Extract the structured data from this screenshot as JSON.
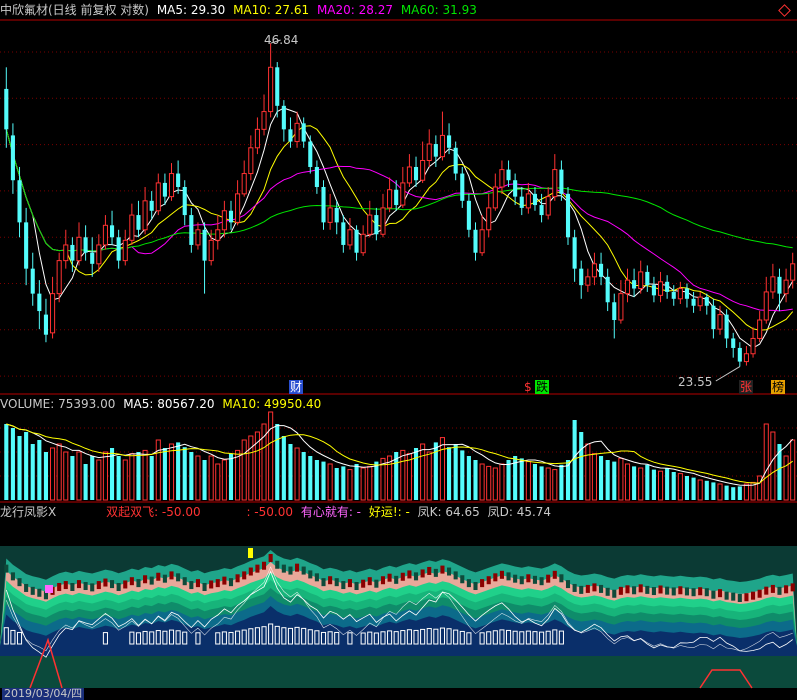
{
  "colors": {
    "bg": "#000000",
    "grid": "#7a0000",
    "up": "#ff3232",
    "down": "#54fcfc",
    "ma5": "#ffffff",
    "ma10": "#ffff00",
    "ma20": "#ff00ff",
    "ma60": "#00e600",
    "label": "#c8c8c8"
  },
  "header_price": {
    "stock": "中欣氟材(日线 前复权 对数)",
    "ma5": "MA5: 29.30",
    "ma10": "MA10: 27.61",
    "ma20": "MA20: 28.27",
    "ma60": "MA60: 31.93",
    "corner_icon": "diamond-icon"
  },
  "header_volume": {
    "volume": "VOLUME: 75393.00",
    "ma5": "MA5: 80567.20",
    "ma10": "MA10: 49950.40"
  },
  "header_indicator": {
    "name": "龙行凤影X",
    "shuangqi": "双起双飞: -50.00",
    "extra": ": -50.00",
    "youxin": "有心就有: -",
    "haoyun": "好运!: -",
    "fengk": "凤K: 64.65",
    "fengd": "凤D: 45.74"
  },
  "annotations": {
    "high": "46.84",
    "low": "23.55",
    "cai": "财",
    "dollar": "$",
    "die": "跌",
    "zhang": "张",
    "bang": "榜"
  },
  "date_label": "2019/03/04/四",
  "chart_data": {
    "type": "candlestick",
    "title": "中欣氟材(日线 前复权 对数)",
    "high_marker": 46.84,
    "low_marker": 23.55,
    "price_range": [
      22.5,
      49
    ],
    "last_ma": {
      "MA5": 29.3,
      "MA10": 27.61,
      "MA20": 28.27,
      "MA60": 31.93
    },
    "candles": [
      {
        "o": 42.5,
        "c": 39,
        "h": 44.5,
        "l": 37.5
      },
      {
        "o": 38.5,
        "c": 35,
        "h": 39.5,
        "l": 34
      },
      {
        "o": 35,
        "c": 32,
        "h": 36,
        "l": 31
      },
      {
        "o": 32,
        "c": 29,
        "h": 33,
        "l": 28
      },
      {
        "o": 29,
        "c": 27.5,
        "h": 30,
        "l": 26.8
      },
      {
        "o": 27.5,
        "c": 26.5,
        "h": 28.3,
        "l": 25.5
      },
      {
        "o": 26.3,
        "c": 25.2,
        "h": 27.2,
        "l": 24.8
      },
      {
        "o": 25.3,
        "c": 27.5,
        "h": 28.5,
        "l": 25
      },
      {
        "o": 27.5,
        "c": 29.5,
        "h": 30,
        "l": 27
      },
      {
        "o": 29.5,
        "c": 30.5,
        "h": 31.5,
        "l": 29
      },
      {
        "o": 30.5,
        "c": 29.5,
        "h": 31,
        "l": 28.8
      },
      {
        "o": 29.5,
        "c": 31,
        "h": 32,
        "l": 29.2
      },
      {
        "o": 31,
        "c": 30,
        "h": 31.8,
        "l": 29.5
      },
      {
        "o": 30,
        "c": 29.3,
        "h": 31,
        "l": 28.5
      },
      {
        "o": 29.3,
        "c": 30.5,
        "h": 31.2,
        "l": 28.8
      },
      {
        "o": 30.5,
        "c": 31.8,
        "h": 32.5,
        "l": 30.2
      },
      {
        "o": 31.8,
        "c": 31,
        "h": 32.8,
        "l": 30.5
      },
      {
        "o": 31,
        "c": 29.5,
        "h": 31.5,
        "l": 29
      },
      {
        "o": 29.5,
        "c": 30.8,
        "h": 31.5,
        "l": 29.2
      },
      {
        "o": 30.8,
        "c": 32.5,
        "h": 33.3,
        "l": 30.5
      },
      {
        "o": 32.5,
        "c": 31.5,
        "h": 33.5,
        "l": 31
      },
      {
        "o": 31.5,
        "c": 33.5,
        "h": 34.5,
        "l": 31.2
      },
      {
        "o": 33.5,
        "c": 32.8,
        "h": 34.2,
        "l": 32.2
      },
      {
        "o": 32.8,
        "c": 34.8,
        "h": 35.5,
        "l": 32.5
      },
      {
        "o": 34.8,
        "c": 33.8,
        "h": 35.5,
        "l": 33.2
      },
      {
        "o": 33.8,
        "c": 35.5,
        "h": 36.3,
        "l": 33.5
      },
      {
        "o": 35.5,
        "c": 34.5,
        "h": 36.5,
        "l": 34
      },
      {
        "o": 34.5,
        "c": 32.5,
        "h": 35,
        "l": 31.8
      },
      {
        "o": 32.5,
        "c": 30.5,
        "h": 33,
        "l": 30
      },
      {
        "o": 30.5,
        "c": 31.5,
        "h": 32,
        "l": 30.2
      },
      {
        "o": 31.5,
        "c": 29.5,
        "h": 32,
        "l": 27.5
      },
      {
        "o": 29.5,
        "c": 30.8,
        "h": 31.5,
        "l": 29.2
      },
      {
        "o": 30.8,
        "c": 31.5,
        "h": 32.5,
        "l": 30.2
      },
      {
        "o": 31.5,
        "c": 32.8,
        "h": 33.5,
        "l": 31
      },
      {
        "o": 32.8,
        "c": 32,
        "h": 33.5,
        "l": 31.5
      },
      {
        "o": 32,
        "c": 34,
        "h": 35,
        "l": 31.8
      },
      {
        "o": 34,
        "c": 35.5,
        "h": 36.5,
        "l": 33.8
      },
      {
        "o": 35.5,
        "c": 37.5,
        "h": 38.5,
        "l": 35
      },
      {
        "o": 37.5,
        "c": 39,
        "h": 40,
        "l": 37
      },
      {
        "o": 39,
        "c": 40.5,
        "h": 42,
        "l": 38.5
      },
      {
        "o": 40.5,
        "c": 44.5,
        "h": 46.84,
        "l": 40
      },
      {
        "o": 44.5,
        "c": 41,
        "h": 45,
        "l": 40
      },
      {
        "o": 41,
        "c": 39,
        "h": 41.5,
        "l": 38
      },
      {
        "o": 39,
        "c": 38,
        "h": 40,
        "l": 37.5
      },
      {
        "o": 38,
        "c": 39.5,
        "h": 40.5,
        "l": 37.5
      },
      {
        "o": 39.5,
        "c": 38,
        "h": 40,
        "l": 37.5
      },
      {
        "o": 38,
        "c": 36,
        "h": 38.5,
        "l": 35.5
      },
      {
        "o": 36,
        "c": 34.5,
        "h": 36.5,
        "l": 34
      },
      {
        "o": 34.5,
        "c": 32,
        "h": 35,
        "l": 31.5
      },
      {
        "o": 32,
        "c": 33,
        "h": 34,
        "l": 31.5
      },
      {
        "o": 33,
        "c": 32,
        "h": 33.5,
        "l": 31.2
      },
      {
        "o": 32,
        "c": 30.5,
        "h": 32.5,
        "l": 30
      },
      {
        "o": 30.5,
        "c": 31.5,
        "h": 32.3,
        "l": 30.2
      },
      {
        "o": 31.5,
        "c": 30,
        "h": 31.8,
        "l": 29.5
      },
      {
        "o": 30,
        "c": 31.2,
        "h": 31.8,
        "l": 29.8
      },
      {
        "o": 31.2,
        "c": 32.5,
        "h": 33.5,
        "l": 31
      },
      {
        "o": 32.5,
        "c": 31.2,
        "h": 33,
        "l": 30.8
      },
      {
        "o": 31.2,
        "c": 33,
        "h": 34,
        "l": 31
      },
      {
        "o": 33,
        "c": 34.3,
        "h": 35.2,
        "l": 32.7
      },
      {
        "o": 34.3,
        "c": 33.2,
        "h": 35,
        "l": 32.8
      },
      {
        "o": 33.2,
        "c": 34.8,
        "h": 36,
        "l": 33
      },
      {
        "o": 34.8,
        "c": 36,
        "h": 37,
        "l": 34.5
      },
      {
        "o": 36,
        "c": 35,
        "h": 36.8,
        "l": 34.5
      },
      {
        "o": 35,
        "c": 36.5,
        "h": 38,
        "l": 34.8
      },
      {
        "o": 36.5,
        "c": 37.8,
        "h": 39,
        "l": 36
      },
      {
        "o": 37.8,
        "c": 36.8,
        "h": 38.5,
        "l": 36
      },
      {
        "o": 36.8,
        "c": 38.5,
        "h": 40.5,
        "l": 36.5
      },
      {
        "o": 38.5,
        "c": 37.5,
        "h": 39.5,
        "l": 37
      },
      {
        "o": 37.5,
        "c": 35.5,
        "h": 38,
        "l": 35
      },
      {
        "o": 35.5,
        "c": 33.5,
        "h": 36,
        "l": 33
      },
      {
        "o": 33.5,
        "c": 31.5,
        "h": 34,
        "l": 31
      },
      {
        "o": 31.5,
        "c": 30,
        "h": 32,
        "l": 29.5
      },
      {
        "o": 30,
        "c": 31.5,
        "h": 32.5,
        "l": 29.8
      },
      {
        "o": 31.5,
        "c": 33,
        "h": 34,
        "l": 31
      },
      {
        "o": 33,
        "c": 34.5,
        "h": 35.5,
        "l": 32.8
      },
      {
        "o": 34.5,
        "c": 35.8,
        "h": 36.5,
        "l": 34
      },
      {
        "o": 35.8,
        "c": 35,
        "h": 36.5,
        "l": 34.5
      },
      {
        "o": 35,
        "c": 33.8,
        "h": 35.5,
        "l": 33.2
      },
      {
        "o": 33.8,
        "c": 33,
        "h": 34.5,
        "l": 32.5
      },
      {
        "o": 33,
        "c": 34,
        "h": 34.8,
        "l": 32.6
      },
      {
        "o": 34,
        "c": 33.2,
        "h": 34.5,
        "l": 32.8
      },
      {
        "o": 33.2,
        "c": 32.5,
        "h": 34,
        "l": 32
      },
      {
        "o": 32.5,
        "c": 33.8,
        "h": 34.5,
        "l": 32.2
      },
      {
        "o": 33.8,
        "c": 35.8,
        "h": 37,
        "l": 33.5
      },
      {
        "o": 35.8,
        "c": 34,
        "h": 36.5,
        "l": 33.5
      },
      {
        "o": 34,
        "c": 31,
        "h": 34.5,
        "l": 30.5
      },
      {
        "o": 31,
        "c": 29,
        "h": 31.5,
        "l": 28.2
      },
      {
        "o": 29,
        "c": 28,
        "h": 29.5,
        "l": 27.2
      },
      {
        "o": 28,
        "c": 28.5,
        "h": 29,
        "l": 27.6
      },
      {
        "o": 28.5,
        "c": 29.3,
        "h": 30,
        "l": 28
      },
      {
        "o": 29.3,
        "c": 28.5,
        "h": 30,
        "l": 28
      },
      {
        "o": 28.5,
        "c": 27,
        "h": 29,
        "l": 26.5
      },
      {
        "o": 27,
        "c": 26,
        "h": 27.5,
        "l": 25
      },
      {
        "o": 26,
        "c": 27.5,
        "h": 28.3,
        "l": 25.8
      },
      {
        "o": 27.5,
        "c": 28.3,
        "h": 29,
        "l": 27
      },
      {
        "o": 28.3,
        "c": 27.8,
        "h": 29,
        "l": 27.3
      },
      {
        "o": 27.8,
        "c": 28.8,
        "h": 29.5,
        "l": 27.5
      },
      {
        "o": 28.8,
        "c": 28,
        "h": 29.2,
        "l": 27.6
      },
      {
        "o": 28,
        "c": 27.4,
        "h": 28.5,
        "l": 27
      },
      {
        "o": 27.4,
        "c": 28.2,
        "h": 28.8,
        "l": 27
      },
      {
        "o": 28.2,
        "c": 27.6,
        "h": 28.6,
        "l": 27.2
      },
      {
        "o": 27.6,
        "c": 27.2,
        "h": 28,
        "l": 26.8
      },
      {
        "o": 27.2,
        "c": 27.8,
        "h": 28.2,
        "l": 26.9
      },
      {
        "o": 27.8,
        "c": 27.2,
        "h": 28.1,
        "l": 26.7
      },
      {
        "o": 27.2,
        "c": 26.8,
        "h": 27.6,
        "l": 26.4
      },
      {
        "o": 26.8,
        "c": 27.3,
        "h": 27.6,
        "l": 26.5
      },
      {
        "o": 27.3,
        "c": 26.8,
        "h": 27.5,
        "l": 26.3
      },
      {
        "o": 26.8,
        "c": 25.5,
        "h": 27.2,
        "l": 25
      },
      {
        "o": 25.5,
        "c": 26.3,
        "h": 26.8,
        "l": 25.2
      },
      {
        "o": 26.3,
        "c": 25,
        "h": 26.6,
        "l": 24.5
      },
      {
        "o": 25,
        "c": 24.5,
        "h": 25.3,
        "l": 24
      },
      {
        "o": 24.5,
        "c": 23.8,
        "h": 24.8,
        "l": 23.55
      },
      {
        "o": 23.8,
        "c": 24.2,
        "h": 24.6,
        "l": 23.6
      },
      {
        "o": 24.2,
        "c": 25,
        "h": 25.6,
        "l": 24
      },
      {
        "o": 25,
        "c": 26,
        "h": 26.5,
        "l": 24.8
      },
      {
        "o": 26,
        "c": 27.6,
        "h": 28.5,
        "l": 25.8
      },
      {
        "o": 27.6,
        "c": 28.5,
        "h": 29.3,
        "l": 27.2
      },
      {
        "o": 28.5,
        "c": 27.5,
        "h": 29,
        "l": 26.5
      },
      {
        "o": 27.5,
        "c": 28.3,
        "h": 29,
        "l": 27
      },
      {
        "o": 28.3,
        "c": 29.3,
        "h": 30,
        "l": 27.8
      }
    ],
    "volume": [
      95,
      90,
      80,
      85,
      70,
      75,
      60,
      65,
      70,
      60,
      55,
      60,
      45,
      55,
      50,
      60,
      65,
      55,
      50,
      58,
      60,
      62,
      55,
      75,
      65,
      70,
      72,
      66,
      60,
      55,
      50,
      55,
      45,
      50,
      58,
      62,
      75,
      80,
      85,
      95,
      110,
      95,
      80,
      70,
      65,
      60,
      55,
      50,
      48,
      45,
      40,
      42,
      38,
      45,
      40,
      42,
      48,
      52,
      55,
      60,
      62,
      58,
      65,
      70,
      60,
      72,
      78,
      66,
      70,
      62,
      55,
      50,
      45,
      42,
      40,
      45,
      50,
      55,
      52,
      48,
      45,
      42,
      40,
      38,
      44,
      50,
      100,
      85,
      70,
      58,
      55,
      50,
      48,
      52,
      45,
      42,
      40,
      44,
      38,
      36,
      40,
      35,
      33,
      30,
      28,
      25,
      24,
      22,
      20,
      18,
      16,
      17,
      20,
      22,
      30,
      95,
      85,
      70,
      55,
      75
    ],
    "volume_range": [
      0,
      110
    ]
  }
}
